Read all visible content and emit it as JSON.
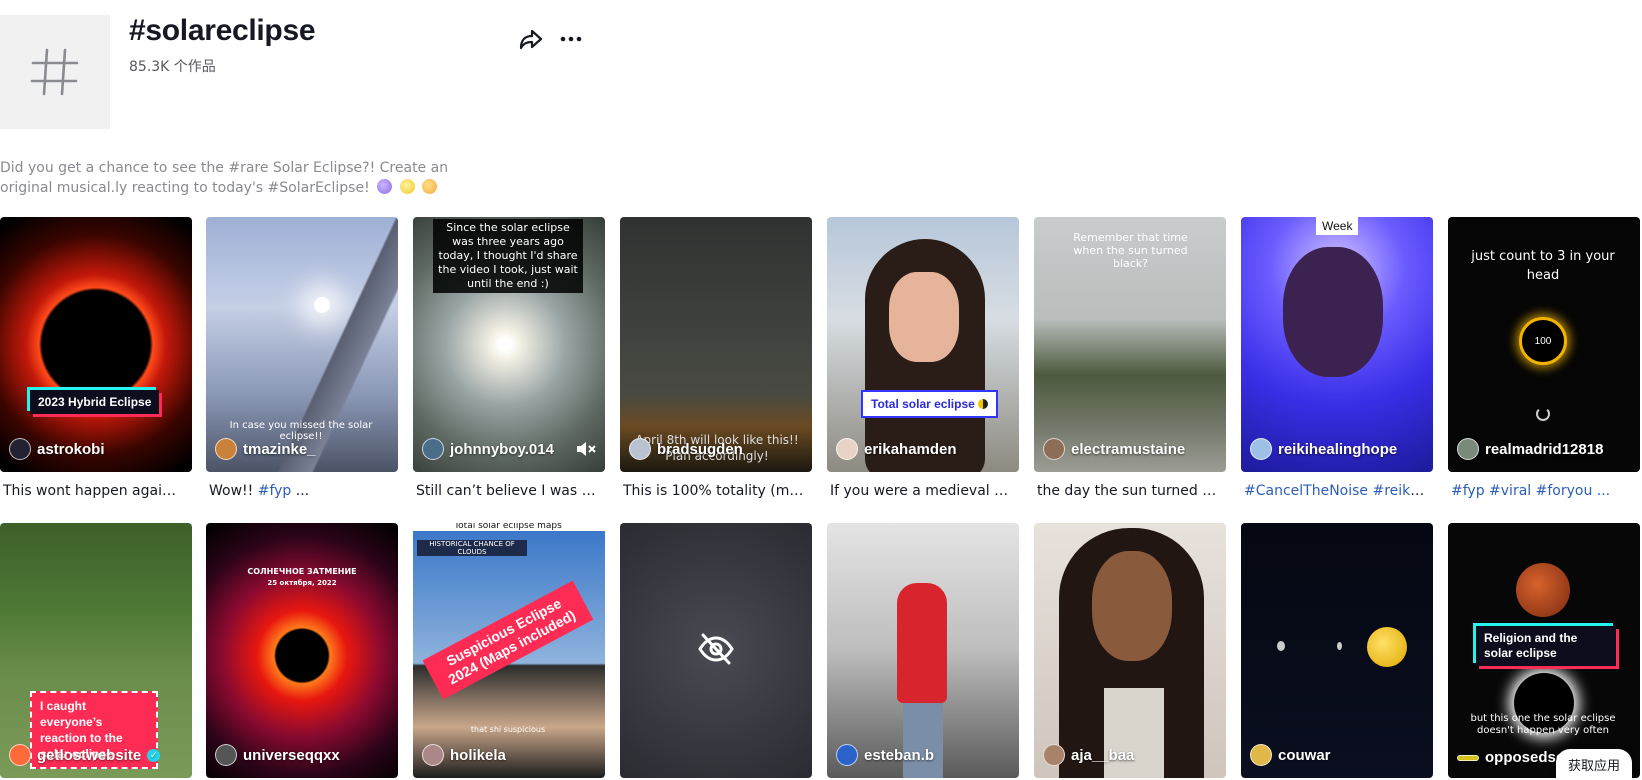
{
  "header": {
    "title": "#solareclipse",
    "count": "85.3K 个作品",
    "hash_symbol": "#"
  },
  "description": {
    "line1": "Did you get a chance to see the #rare Solar Eclipse?! Create an",
    "line2": "original musical.ly reacting to today's #SolarEclipse!"
  },
  "videos_row1": [
    {
      "user": "astrokobi",
      "caption": "This wont happen again ...",
      "overlay": "2023 Hybrid Eclipse"
    },
    {
      "user": "tmazinke_",
      "caption_pre": "Wow!! ",
      "caption_tag": "#fyp",
      "caption_post": " ...",
      "overlay": "In case you missed the solar eclipse!!"
    },
    {
      "user": "johnnyboy.014",
      "caption": "Still can’t believe I was a...",
      "overlay": "Since the solar eclipse was three years ago today, I thought I'd share the video I took, just wait until the end :)"
    },
    {
      "user": "bradsugden",
      "caption": "This is 100% totality (mo...",
      "overlay": "April 8th will look like this!! Plan accordingly!"
    },
    {
      "user": "erikahamden",
      "caption": "If you were a medieval p...",
      "overlay": "Total solar eclipse"
    },
    {
      "user": "electramustaine",
      "caption": "the day the sun turned bl...",
      "overlay": "Remember that time when the sun turned black?"
    },
    {
      "user": "reikihealinghope",
      "caption_tag": "#CancelTheNoise #reiki",
      "caption_post": " ...",
      "overlay": "Week"
    },
    {
      "user": "realmadrid12818",
      "caption_tag": "#fyp #viral #foryou",
      "caption_post": " ...",
      "overlay": "just count to 3 in your head",
      "dial": "100"
    }
  ],
  "videos_row2": [
    {
      "user": "getlostwebsite",
      "overlay": "I caught everyone’s reaction to the solar eclipse"
    },
    {
      "user": "universeqqxx",
      "overlay": "СОЛНЕЧНОЕ ЗАТМЕНИЕ",
      "overlay2": "25 октября, 2022"
    },
    {
      "user": "holikela",
      "overlay": "Suspicious Eclipse 2024 (Maps included)",
      "overlay2": "Total solar eclipse maps",
      "overlay3": "HISTORICAL CHANCE OF CLOUDS",
      "overlay4": "that shi suspicious"
    },
    {
      "user": "",
      "overlay": "hidden"
    },
    {
      "user": "esteban.b",
      "overlay": ""
    },
    {
      "user": "aja__baa",
      "overlay": ""
    },
    {
      "user": "couwar",
      "overlay": ""
    },
    {
      "user": "opposedsocially",
      "overlay": "Religion and the solar eclipse",
      "overlay2": "but this one the solar eclipse doesn't happen very often"
    }
  ],
  "get_app": "获取应用",
  "icons": {
    "share": "share-icon",
    "more": "more-icon",
    "mute": "mute-icon",
    "hidden": "eye-off-icon",
    "verified": "verified-icon"
  }
}
